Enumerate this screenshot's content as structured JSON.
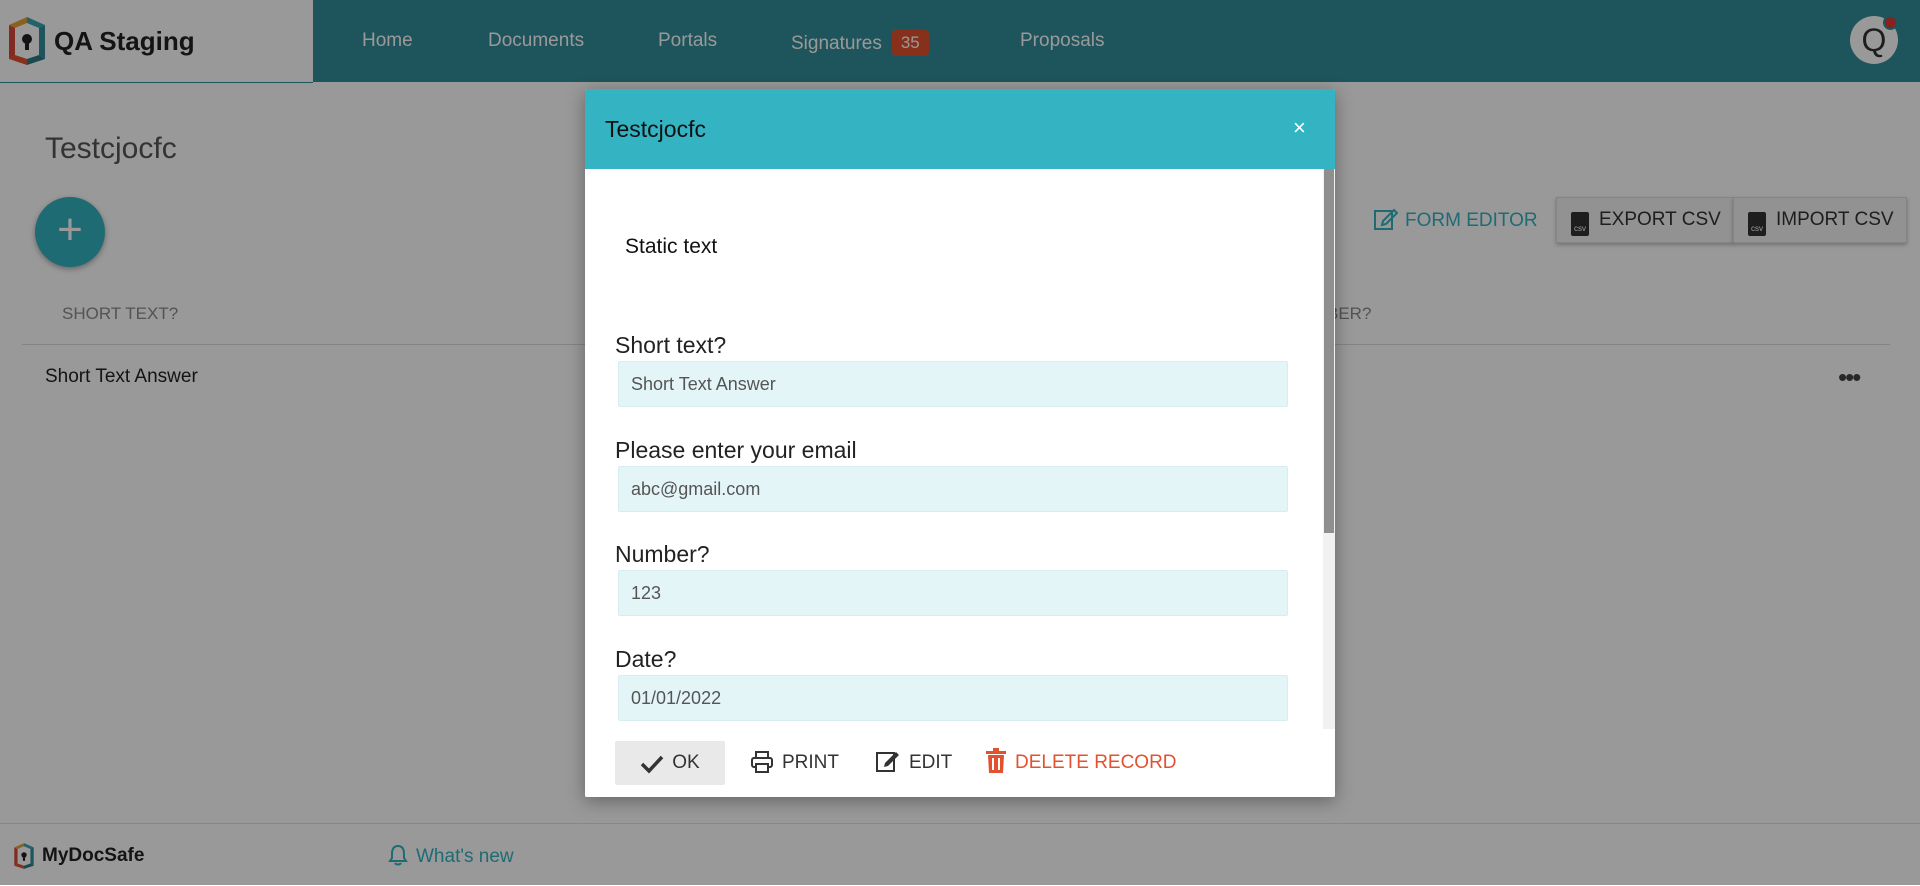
{
  "header": {
    "app_name": "QA Staging",
    "nav": {
      "home": "Home",
      "documents": "Documents",
      "portals": "Portals",
      "signatures": "Signatures",
      "signatures_count": "35",
      "proposals": "Proposals"
    },
    "avatar_initial": "Q"
  },
  "page": {
    "title": "Testcjocfc",
    "add_label": "+",
    "toolbar": {
      "form_editor": "FORM EDITOR",
      "export_csv": "EXPORT CSV",
      "import_csv": "IMPORT CSV",
      "csv_icon_text": "csv"
    },
    "table": {
      "headers": [
        "SHORT TEXT?",
        "BER?"
      ],
      "rows": [
        [
          "Short Text Answer"
        ]
      ],
      "row_menu": "•••"
    }
  },
  "modal": {
    "title": "Testcjocfc",
    "close_label": "×",
    "static_text": "Static text",
    "fields": [
      {
        "label": "Short text?",
        "value": "Short Text Answer"
      },
      {
        "label": "Please enter your email",
        "value": "abc@gmail.com"
      },
      {
        "label": "Number?",
        "value": "123"
      },
      {
        "label": "Date?",
        "value": "01/01/2022"
      }
    ],
    "actions": {
      "ok": "OK",
      "print": "PRINT",
      "edit": "EDIT",
      "delete": "DELETE RECORD"
    }
  },
  "footer": {
    "brand": "MyDocSafe",
    "whats_new": "What's new"
  },
  "colors": {
    "nav_bg": "#338d98",
    "accent": "#34b3c2",
    "danger": "#e2522f",
    "input_bg": "#e4f5f8"
  }
}
